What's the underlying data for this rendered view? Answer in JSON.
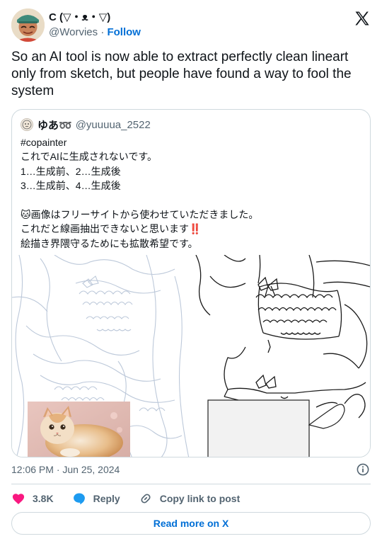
{
  "author": {
    "name": "C (▽・ᴥ・▽)",
    "handle": "@Worvies",
    "separator": "·",
    "follow_label": "Follow"
  },
  "tweet": {
    "text": "So an AI tool is now able to extract perfectly clean lineart only from sketch, but people have found a way to fool the system"
  },
  "quote": {
    "name": "ゆあ➿",
    "handle": "@yuuuua_2522",
    "lines": [
      "#copainter",
      "これでAIに生成されないです。",
      "1…生成前、2…生成後",
      "3…生成前、4…生成後",
      "",
      "🐱画像はフリーサイトから使わせていただきました。",
      "これだと線画抽出できないと思います‼️",
      "絵描き界隈守るためにも拡散希望です。"
    ]
  },
  "meta": {
    "time": "12:06 PM · Jun 25, 2024"
  },
  "actions": {
    "likes": "3.8K",
    "reply": "Reply",
    "copy": "Copy link to post"
  },
  "read_more": "Read more on X",
  "colors": {
    "accent": "#006fd6",
    "like": "#f91880",
    "reply_bubble": "#1d9bf0",
    "border": "#cfd9de",
    "muted": "#536471"
  }
}
